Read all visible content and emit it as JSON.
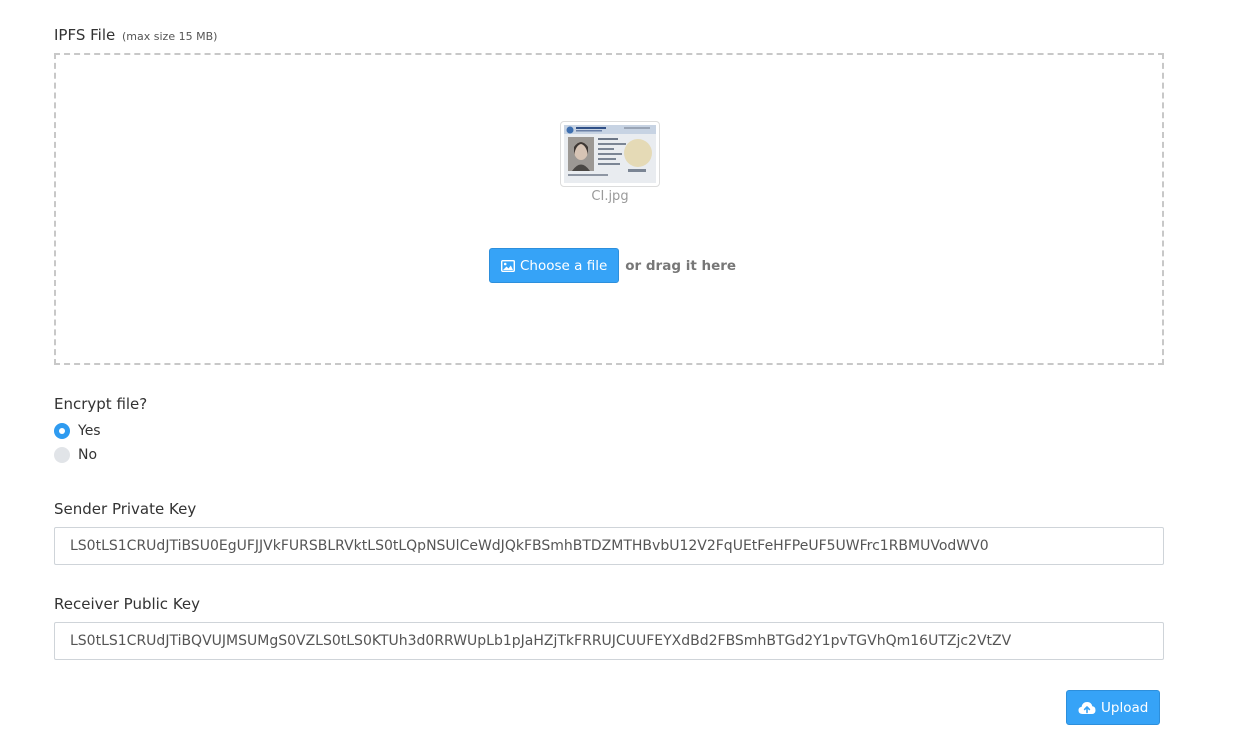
{
  "file_section": {
    "label": "IPFS File",
    "hint": "(max size 15 MB)",
    "file_name": "CI.jpg",
    "choose_label": "Choose a file",
    "drag_text": "or drag it here"
  },
  "encrypt": {
    "label": "Encrypt file?",
    "options": [
      {
        "label": "Yes",
        "selected": true
      },
      {
        "label": "No",
        "selected": false
      }
    ]
  },
  "sender": {
    "label": "Sender Private Key",
    "value": "LS0tLS1CRUdJTiBSU0EgUFJJVkFURSBLRVktLS0tLQpNSUlCeWdJQkFBSmhBTDZMTHBvbU12V2FqUEtFeHFPeUF5UWFrc1RBMUVodWV0"
  },
  "receiver": {
    "label": "Receiver Public Key",
    "value": "LS0tLS1CRUdJTiBQVUJMSUMgS0VZLS0tLS0KTUh3d0RRWUpLb1pJaHZjTkFRRUJCUUFEYXdBd2FBSmhBTGd2Y1pvTGVhQm16UTZjc2VtZV"
  },
  "upload": {
    "label": "Upload"
  },
  "colors": {
    "primary": "#36a3f7",
    "radio_checked": "#2f9bf0",
    "dashed_border": "#c8c8c8"
  }
}
